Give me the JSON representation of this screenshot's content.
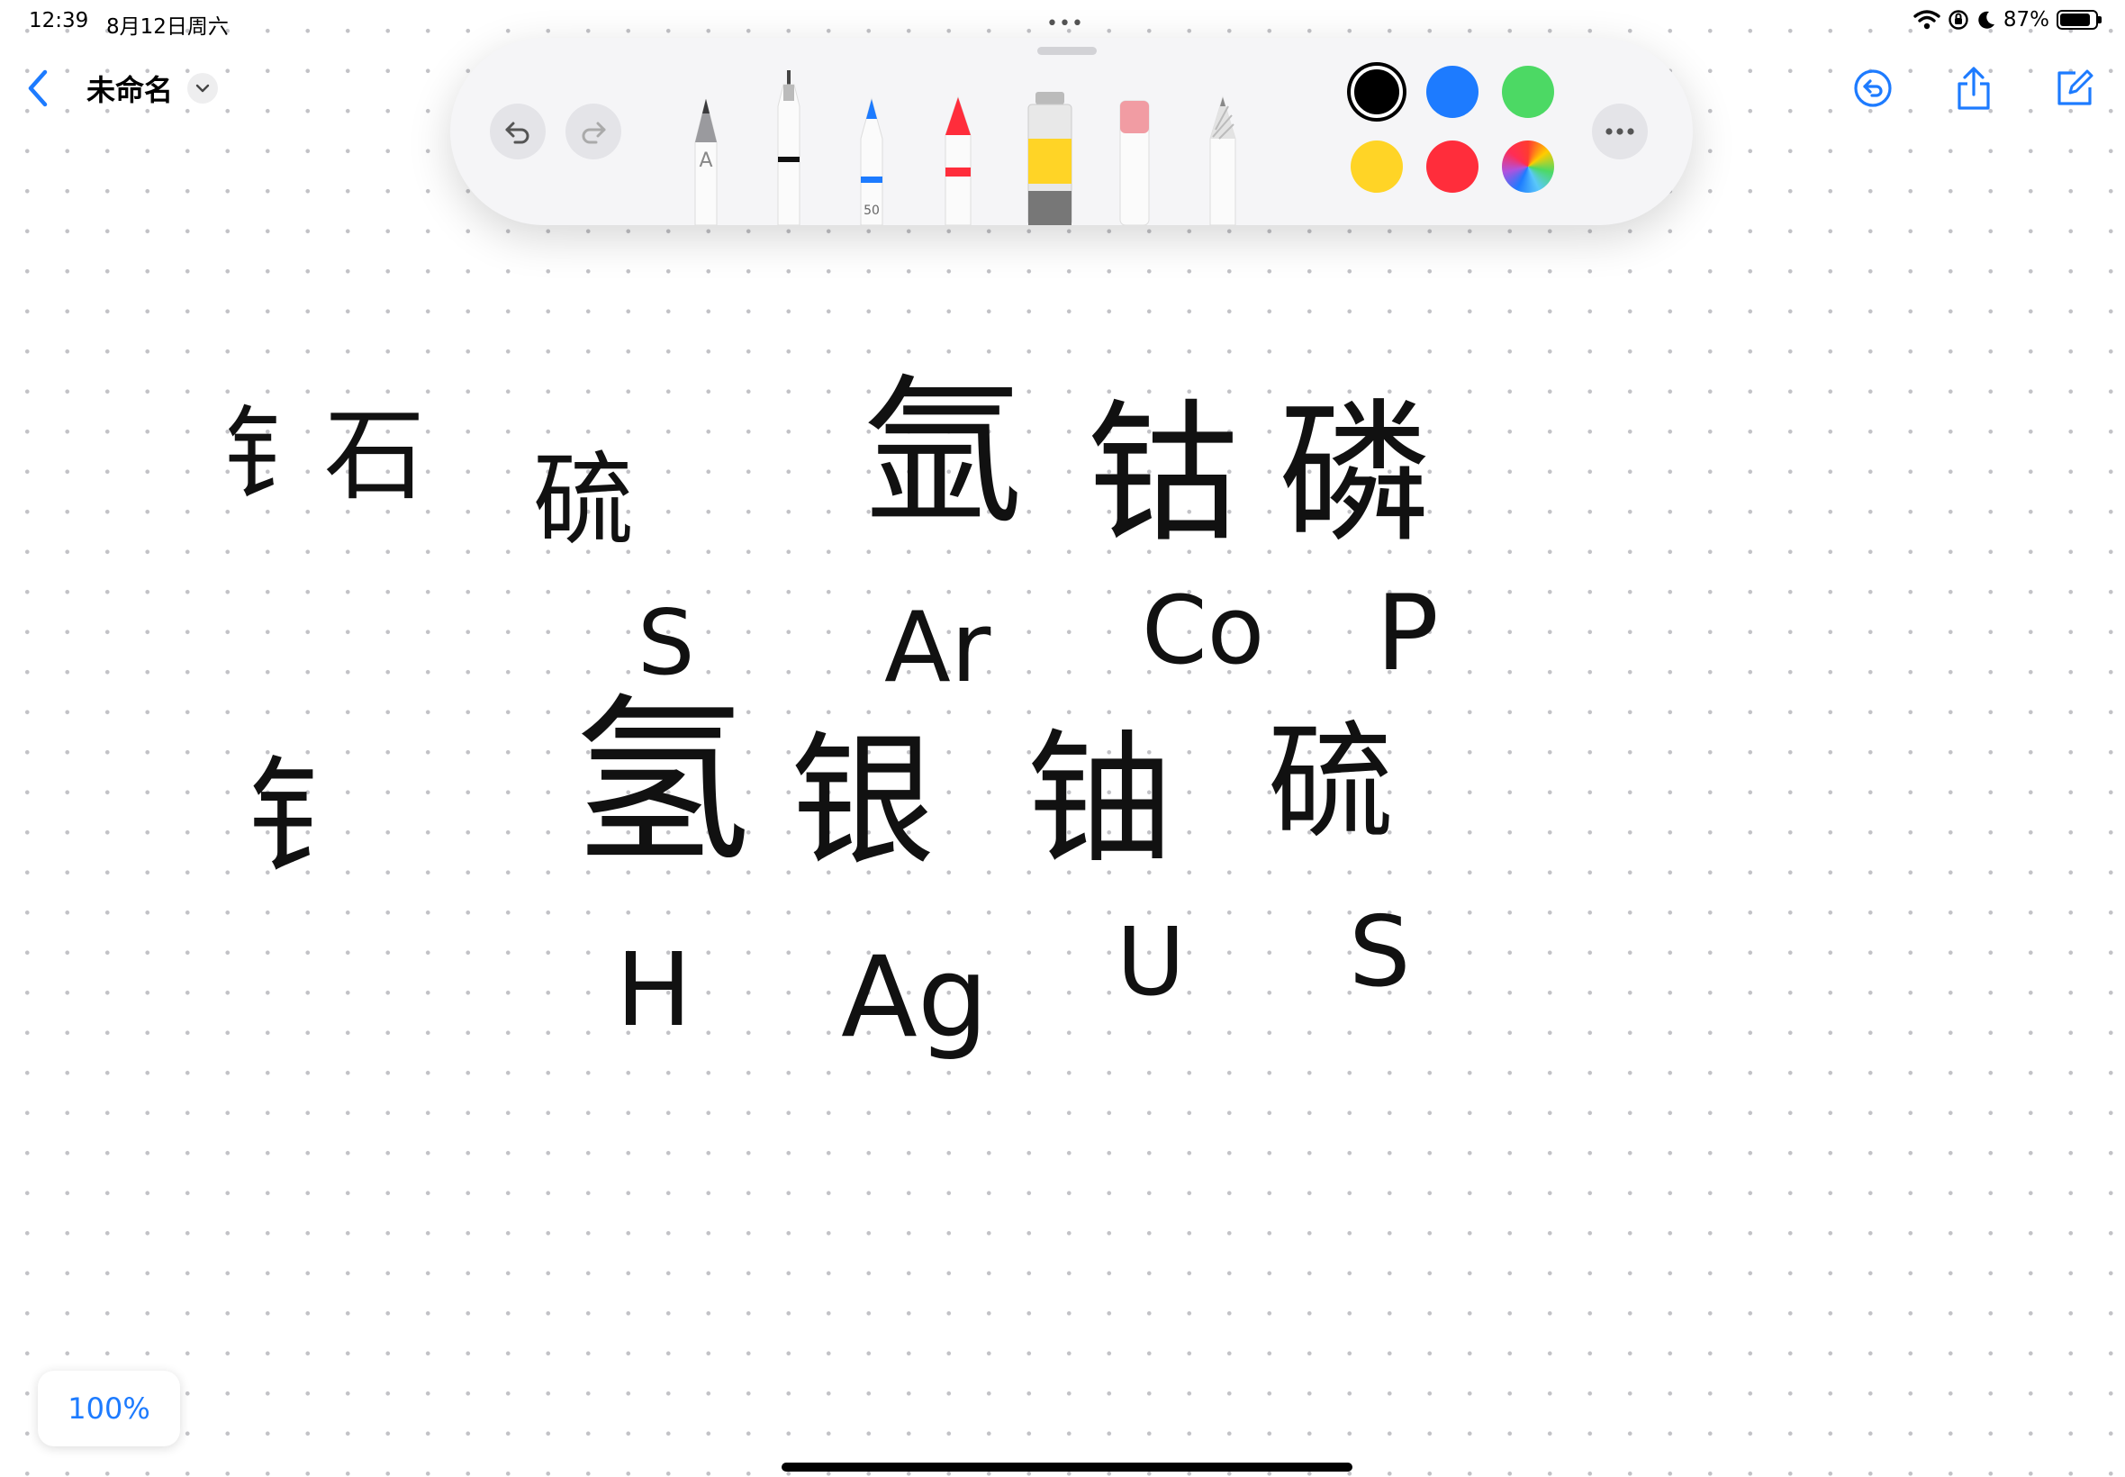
{
  "status_bar": {
    "time": "12:39",
    "date": "8月12日周六",
    "battery_text": "87%",
    "battery_level": 0.87
  },
  "nav": {
    "title": "未命名",
    "accent_color": "#1d7bff"
  },
  "toolbar": {
    "tools": [
      {
        "name": "monoline-pen",
        "label": "A"
      },
      {
        "name": "fineliner"
      },
      {
        "name": "pen",
        "label": "50"
      },
      {
        "name": "crayon"
      },
      {
        "name": "watercolor"
      },
      {
        "name": "eraser"
      },
      {
        "name": "pencil"
      }
    ],
    "colors": [
      "#000000",
      "#1d7bff",
      "#4cd964",
      "#ffd426",
      "#ff2d3b",
      "multicolor"
    ],
    "selected_color": "#000000"
  },
  "canvas": {
    "row1_label": "钅石",
    "row1_elements": [
      "硫",
      "氩",
      "钴",
      "磷"
    ],
    "row1_symbols": [
      "S",
      "Ar",
      "Co",
      "P"
    ],
    "row2_label": "钅",
    "row2_elements": [
      "氢",
      "银",
      "铀",
      "硫"
    ],
    "row2_symbols": [
      "H",
      "Ag",
      "U",
      "S"
    ]
  },
  "zoom": {
    "level": "100%"
  }
}
